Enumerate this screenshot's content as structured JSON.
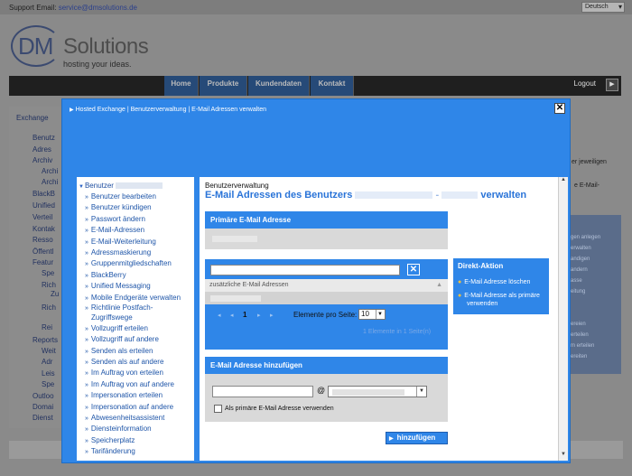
{
  "header": {
    "support_label": "Support Email:",
    "support_email": "service@dmsolutions.de",
    "language": "Deutsch",
    "logo_dm": "DM",
    "logo_solutions": "Solutions",
    "logo_tagline": "hosting your ideas."
  },
  "nav": {
    "items": [
      "Home",
      "Produkte",
      "Kundendaten",
      "Kontakt"
    ],
    "logout": "Logout"
  },
  "bg_sidebar": {
    "items": [
      "Exchange",
      "Benutz",
      "Adres",
      "Archiv",
      "Archi",
      "Archi",
      "BlackB",
      "Unified",
      "Verteil",
      "Kontak",
      "Resso",
      "Öffentl",
      "Featur",
      "Spe",
      "Rich",
      "Zu",
      "Rich",
      "Rei",
      "Reports",
      "Weit",
      "Adr",
      "Leis",
      "Spe",
      "Outloo",
      "Domai",
      "Dienst"
    ]
  },
  "bg_right": {
    "texts": [
      "er jeweiligen",
      "e E-Mail-"
    ],
    "box_items": [
      "gen anlegen",
      "erwalten",
      "andigen",
      "andern",
      "asse",
      "eitung",
      "",
      "ereien",
      "erteilen",
      "m erteilen",
      "ereiten"
    ]
  },
  "modal": {
    "breadcrumb": "Hosted Exchange | Benutzerverwaltung | E-Mail Adressen verwalten",
    "close": "✕"
  },
  "left_panel": {
    "head": "Benutzer",
    "items": [
      "Benutzer bearbeiten",
      "Benutzer kündigen",
      "Passwort ändern",
      "E-Mail-Adressen",
      "E-Mail-Weiterleitung",
      "Adressmaskierung",
      "Gruppenmitgliedschaften",
      "BlackBerry",
      "Unified Messaging",
      "Mobile Endgeräte verwalten",
      "Richtlinie Postfach-Zugriffswege",
      "Vollzugriff erteilen",
      "Vollzugriff auf andere",
      "Senden als erteilen",
      "Senden als auf andere",
      "Im Auftrag von erteilen",
      "Im Auftrag von auf andere",
      "Impersonation erteilen",
      "Impersonation auf andere",
      "Abwesenheitsassistent",
      "Diensteinformation",
      "Speicherplatz",
      "Tarifänderung"
    ]
  },
  "main": {
    "subtitle": "Benutzerverwaltung",
    "title_prefix": "E-Mail Adressen des Benutzers",
    "title_suffix": "verwalten",
    "primary_section": "Primäre E-Mail Adresse",
    "additional_label": "zusätzliche E-Mail Adressen",
    "pager": {
      "current_page": "1",
      "per_page_label": "Elemente pro Seite:",
      "per_page_value": "10",
      "summary": "1 Elemente in 1 Seite(n)"
    },
    "add_section": "E-Mail Adresse hinzufügen",
    "at_sign": "@",
    "checkbox_label": "Als primäre E-Mail Adresse verwenden",
    "add_button": "hinzufügen"
  },
  "direkt_aktion": {
    "head": "Direkt-Aktion",
    "items": [
      "E-Mail Adresse löschen",
      "E-Mail Adresse als primäre verwenden"
    ]
  },
  "colors": {
    "accent": "#2f86e8",
    "link": "#1e55a8",
    "nav_bg": "#1f1f1f"
  }
}
